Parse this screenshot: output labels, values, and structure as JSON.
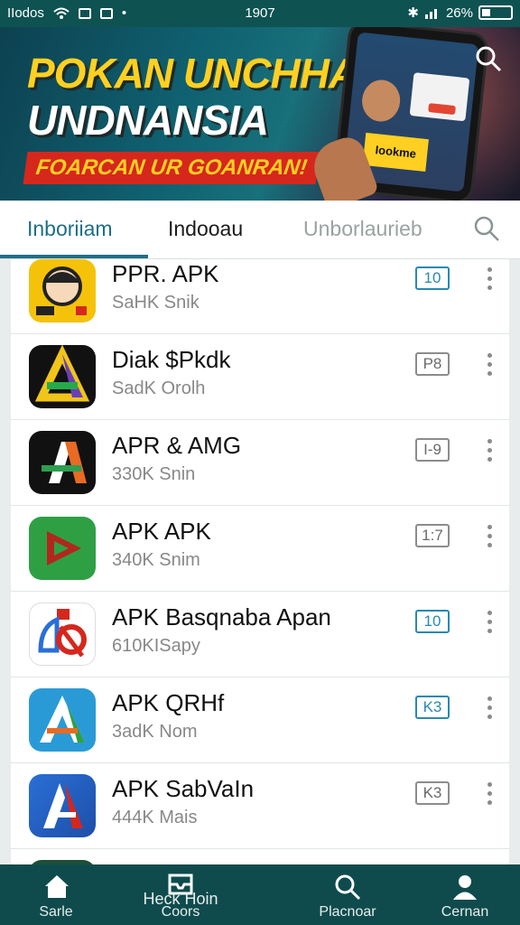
{
  "status_bar": {
    "carrier": "IIodos",
    "time": "1907",
    "battery": "26%"
  },
  "banner": {
    "line1": "POKAN UNCHHA",
    "line2": "UNDNANSIA",
    "tagline": "FOARCAN UR GOANRAN!",
    "phone_text": "Iookme"
  },
  "tabs": [
    {
      "label": "Inboriiam"
    },
    {
      "label": "Indooau"
    },
    {
      "label": "Unborlaurieb"
    }
  ],
  "apps": [
    {
      "title": "PPR. APK",
      "subtitle": "SaHK Snik",
      "badge": "10"
    },
    {
      "title": "Diak $Pkdk",
      "subtitle": "SadK Orolh",
      "badge": "P8"
    },
    {
      "title": "APR & AMG",
      "subtitle": "330K Snin",
      "badge": "I-9"
    },
    {
      "title": "APK APK",
      "subtitle": "340K Snim",
      "badge": "1:7"
    },
    {
      "title": "APK Basqnaba Apan",
      "subtitle": "610KISapy",
      "badge": "10"
    },
    {
      "title": "APK QRHf",
      "subtitle": "3adK Nom",
      "badge": "K3"
    },
    {
      "title": "APK SabVaIn",
      "subtitle": "444K Mais",
      "badge": "K3"
    }
  ],
  "bottom_nav": [
    {
      "label": "Sarle",
      "icon": "home-icon"
    },
    {
      "label": "Coors",
      "icon": "inbox-icon",
      "overlay": "Heck Hoin"
    },
    {
      "label": "Placnoar",
      "icon": "search-icon"
    },
    {
      "label": "Cernan",
      "icon": "person-icon"
    }
  ],
  "colors": {
    "brand": "#0f5252",
    "accent": "#1d6f84",
    "badge_blue": "#2a89b0"
  }
}
